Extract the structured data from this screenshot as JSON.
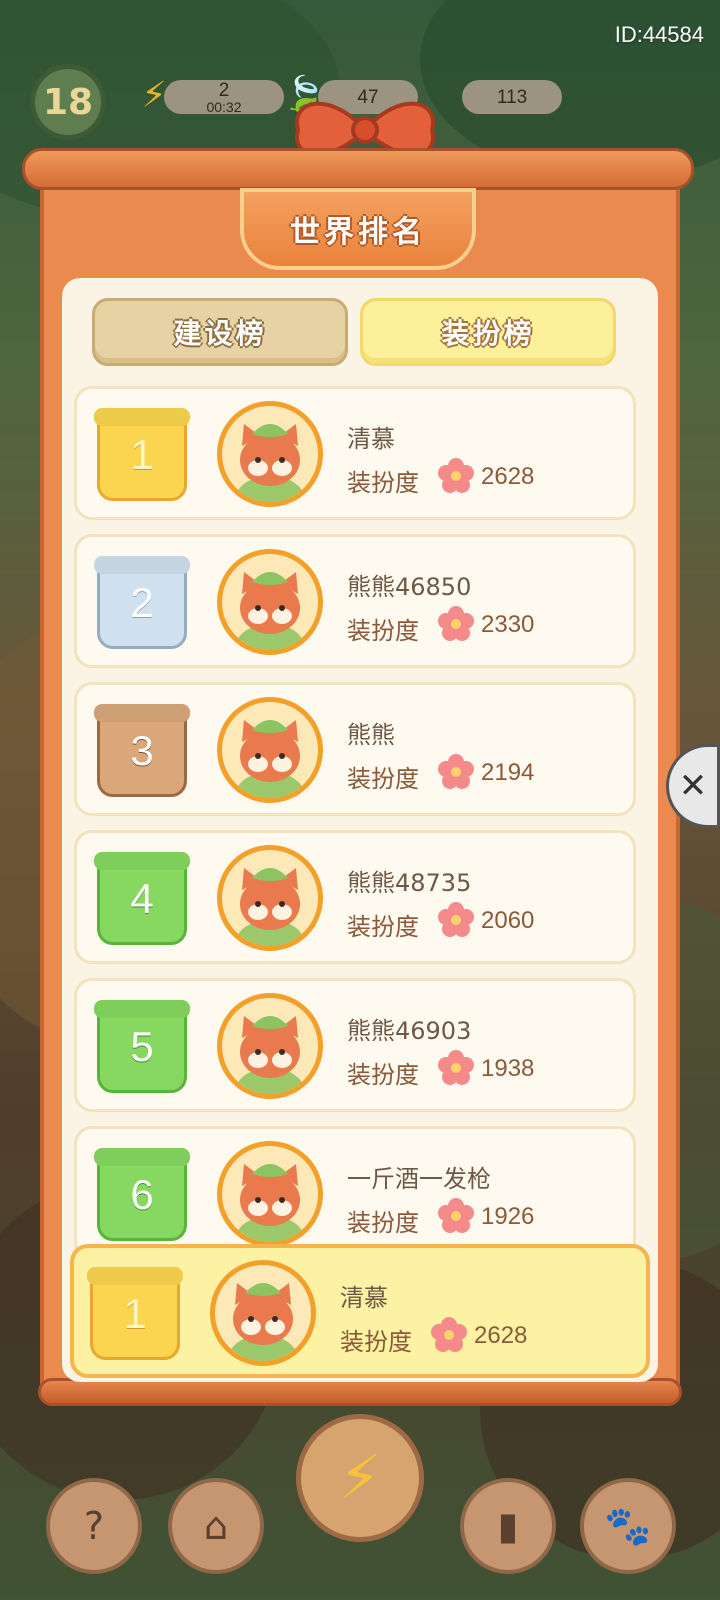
{
  "header": {
    "player_id": "ID:44584"
  },
  "hud": {
    "level": "18",
    "energy": {
      "count": "2",
      "timer": "00:32"
    },
    "currency_leaf": "47",
    "currency_gem": "113"
  },
  "leaderboard": {
    "title": "世界排名",
    "tabs": [
      {
        "label": "建设榜",
        "active": false
      },
      {
        "label": "装扮榜",
        "active": true
      }
    ],
    "score_label": "装扮度",
    "rows": [
      {
        "rank": "1",
        "name": "清慕",
        "score": "2628",
        "medal": "gold"
      },
      {
        "rank": "2",
        "name": "熊熊46850",
        "score": "2330",
        "medal": "silver"
      },
      {
        "rank": "3",
        "name": "熊熊",
        "score": "2194",
        "medal": "bronze"
      },
      {
        "rank": "4",
        "name": "熊熊48735",
        "score": "2060",
        "medal": "green"
      },
      {
        "rank": "5",
        "name": "熊熊46903",
        "score": "1938",
        "medal": "green"
      },
      {
        "rank": "6",
        "name": "一斤酒一发枪",
        "score": "1926",
        "medal": "green"
      }
    ],
    "my_rank": {
      "rank": "1",
      "name": "清慕",
      "score": "2628",
      "medal": "gold"
    }
  },
  "bottom_nav": [
    {
      "icon": "help-cat-icon"
    },
    {
      "icon": "house-icon"
    },
    {
      "icon": "lightning-icon"
    },
    {
      "icon": "book-icon"
    },
    {
      "icon": "paw-bag-icon"
    }
  ],
  "colors": {
    "panel_orange": "#eb8a4e",
    "inner_cream": "#fbf4e4",
    "accent_gold": "#f3a02a",
    "text_brown": "#8a5a3a"
  }
}
